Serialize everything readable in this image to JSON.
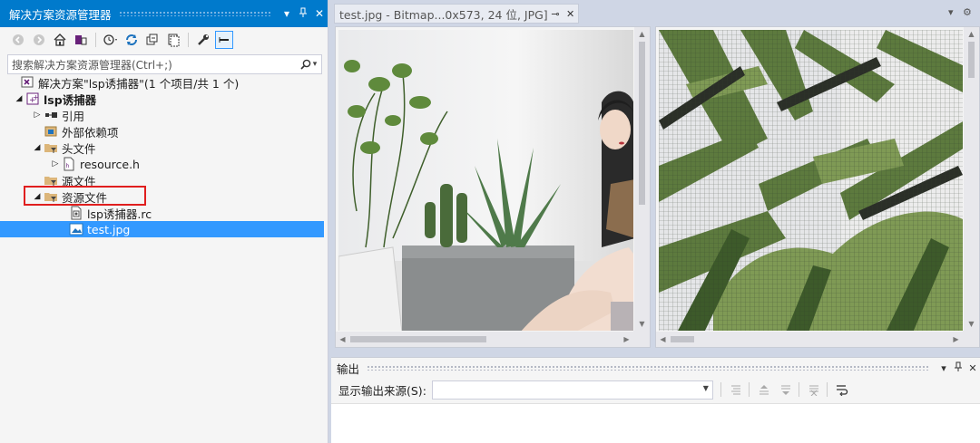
{
  "solution_explorer": {
    "title": "解决方案资源管理器",
    "search_placeholder": "搜索解决方案资源管理器(Ctrl+;)",
    "tree": [
      {
        "label": "解决方案\"lsp诱捕器\"(1 个项目/共 1 个)",
        "icon": "solution-icon"
      },
      {
        "label": "lsp诱捕器",
        "icon": "cpp-project-icon"
      },
      {
        "label": "引用",
        "icon": "references-icon"
      },
      {
        "label": "外部依赖项",
        "icon": "external-deps-icon"
      },
      {
        "label": "头文件",
        "icon": "filter-folder-icon"
      },
      {
        "label": "resource.h",
        "icon": "header-file-icon"
      },
      {
        "label": "源文件",
        "icon": "filter-folder-icon"
      },
      {
        "label": "资源文件",
        "icon": "filter-folder-icon"
      },
      {
        "label": "lsp诱捕器.rc",
        "icon": "rc-file-icon"
      },
      {
        "label": "test.jpg",
        "icon": "image-file-icon"
      }
    ]
  },
  "editor": {
    "tab_title": "test.jpg - Bitmap...0x573, 24 位, JPG]"
  },
  "output": {
    "title": "输出",
    "source_label": "显示输出来源(S):",
    "source_value": ""
  },
  "colors": {
    "accent": "#007acc",
    "selection": "#3399ff",
    "highlight_box": "#e01e1e"
  }
}
